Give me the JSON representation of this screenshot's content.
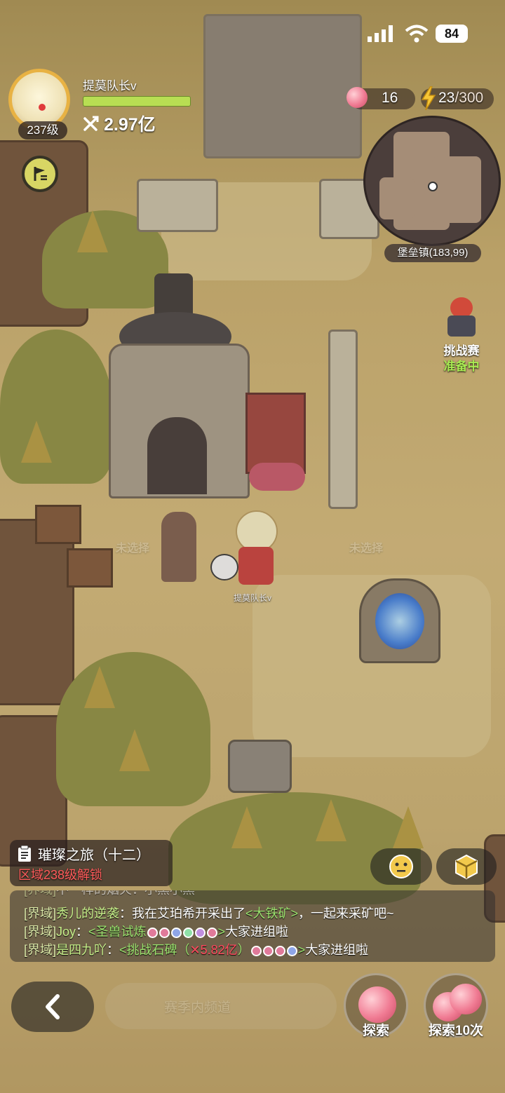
{
  "status_bar": {
    "battery": "84"
  },
  "player": {
    "name": "提莫队长v",
    "level": "237级",
    "power": "2.97亿"
  },
  "resources": {
    "apples": "16",
    "energy": "23",
    "energy_max": "/300"
  },
  "minimap": {
    "location": "堡垒镇(183,99)"
  },
  "challenge": {
    "title": "挑战赛",
    "status": "准备中"
  },
  "map_labels": {
    "player_tag": "提莫队长v",
    "blurred_left": "未选择",
    "blurred_right": "未选择"
  },
  "quest": {
    "title": "璀璨之旅（十二）",
    "subtitle": "区域238级解锁"
  },
  "chat": {
    "line0": {
      "channel": "[界域]",
      "text": "不一样的烟火：小黑小黑"
    },
    "line1": {
      "channel": "[界域]",
      "name": "秀儿的逆袭",
      "text": "：我在艾珀希开采出了",
      "link": "<大铁矿>",
      "tail": "，一起来采矿吧~"
    },
    "line2": {
      "channel": "[界域]",
      "name": "Joy",
      "text": "：",
      "link": "<圣兽试炼",
      "link_end": ">",
      "tail": "大家进组啦"
    },
    "line3": {
      "channel": "[界域]",
      "name": "是四九吖",
      "text": "：",
      "link": "<挑战石碑（",
      "power": "5.82亿",
      "paren": "）",
      "link_end": ">",
      "tail": "大家进组啦"
    }
  },
  "bottom": {
    "input_placeholder": "赛季内频道",
    "explore": "探索",
    "explore10": "探索10次"
  },
  "icons": [
    "signal-icon",
    "wifi-icon",
    "apple-icon",
    "lightning-icon",
    "power-icon",
    "flag-icon",
    "quest-icon",
    "emoji-icon",
    "cube-icon",
    "back-arrow-icon"
  ],
  "colors": {
    "level_ring": "#e8b243",
    "hp_bar": "#b8de53",
    "energy": "#f6c636",
    "quest_sub": "#ff5a5a"
  }
}
